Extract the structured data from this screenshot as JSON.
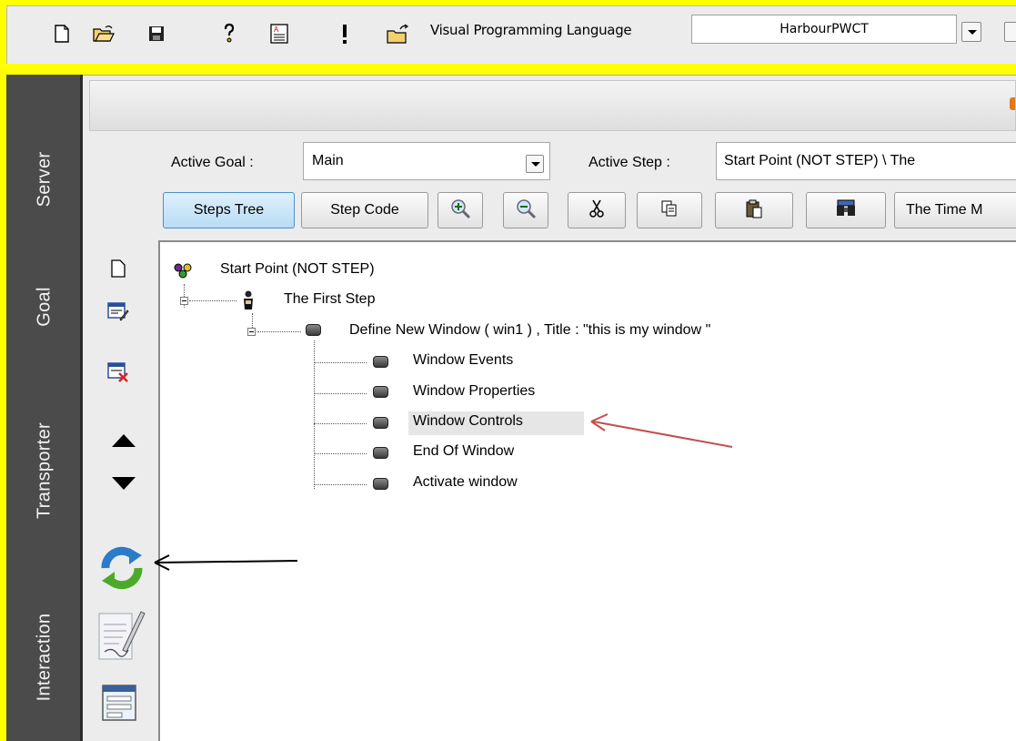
{
  "toolbar": {
    "icons": [
      "new-file-icon",
      "open-folder-icon",
      "save-icon",
      "help-icon",
      "text-editor-icon",
      "run-icon",
      "open-project-icon"
    ],
    "language_label": "Visual Programming Language",
    "language_value": "HarbourPWCT"
  },
  "side_tabs": [
    "Server",
    "Goal",
    "Transporter",
    "Interaction"
  ],
  "goal": {
    "active_goal_label": "Active Goal :",
    "active_goal_value": "Main",
    "active_step_label": "Active Step :",
    "active_step_value": "Start Point (NOT STEP) \\ The"
  },
  "buttons": {
    "steps_tree": "Steps Tree",
    "step_code": "Step Code",
    "time_machine": "The Time M"
  },
  "tree": {
    "root": "Start Point (NOT STEP)",
    "first_step": "The First Step",
    "define_window": "Define New Window  ( win1 ) , Title : \"this is my window  \"",
    "children": [
      "Window Events",
      "Window Properties",
      "Window Controls",
      "End Of Window",
      "Activate window"
    ]
  },
  "annotations": {
    "red_arrow_color": "#c0504d",
    "black_arrow_color": "#000000"
  }
}
